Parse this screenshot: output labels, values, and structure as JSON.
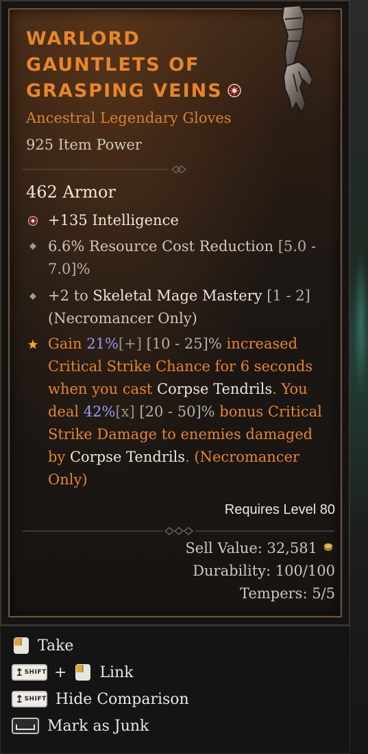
{
  "item": {
    "name_lines": [
      "WARLORD",
      "GAUNTLETS OF",
      "GRASPING VEINS"
    ],
    "type": "Ancestral Legendary Gloves",
    "item_power": "925 Item Power",
    "armor": "462 Armor",
    "affixes": [
      {
        "icon": "unique-star-icon",
        "text": "+135 Intelligence"
      },
      {
        "icon": "diamond-bullet-icon",
        "text": "6.6% Resource Cost Reduction",
        "range": "[5.0 - 7.0]%"
      },
      {
        "icon": "diamond-bullet-icon",
        "prefix": "+2 to ",
        "skill": "Skeletal Mage Mastery",
        "range": "[1 - 2]",
        "suffix": "(Necromancer Only)"
      }
    ],
    "aspect": {
      "icon": "legendary-star-icon",
      "gain": "Gain ",
      "value1": "21%",
      "mod1": "[+]",
      "range1": " [10 - 25]%",
      "text1": " increased Critical Strike Chance for 6 seconds when you cast ",
      "skill1": "Corpse Tendrils",
      "text2": ". You deal ",
      "value2": "42%",
      "mod2": "[x]",
      "range2": " [20 - 50]%",
      "text3": " bonus Critical Strike Damage to enemies damaged by ",
      "skill2": "Corpse Tendrils",
      "text4": ". (Necromancer Only)"
    },
    "requires": "Requires Level 80",
    "sell_value": "Sell Value: 32,581",
    "durability": "Durability: 100/100",
    "tempers": "Tempers: 5/5"
  },
  "actions": [
    {
      "key": "left-mouse-icon",
      "label": "Take"
    },
    {
      "key": "shift-key-icon",
      "key_text": "SHIFT",
      "plus": "+",
      "key2": "left-mouse-icon",
      "label": "Link"
    },
    {
      "key": "shift-key-icon",
      "key_text": "SHIFT",
      "label": "Hide Comparison"
    },
    {
      "key": "space-key-icon",
      "label": "Mark as Junk"
    }
  ],
  "colors": {
    "legendary_orange": "#e8852a",
    "value_blue": "#9b9bef",
    "frame_brown": "#6f563c",
    "text_light": "#ede6dc"
  }
}
